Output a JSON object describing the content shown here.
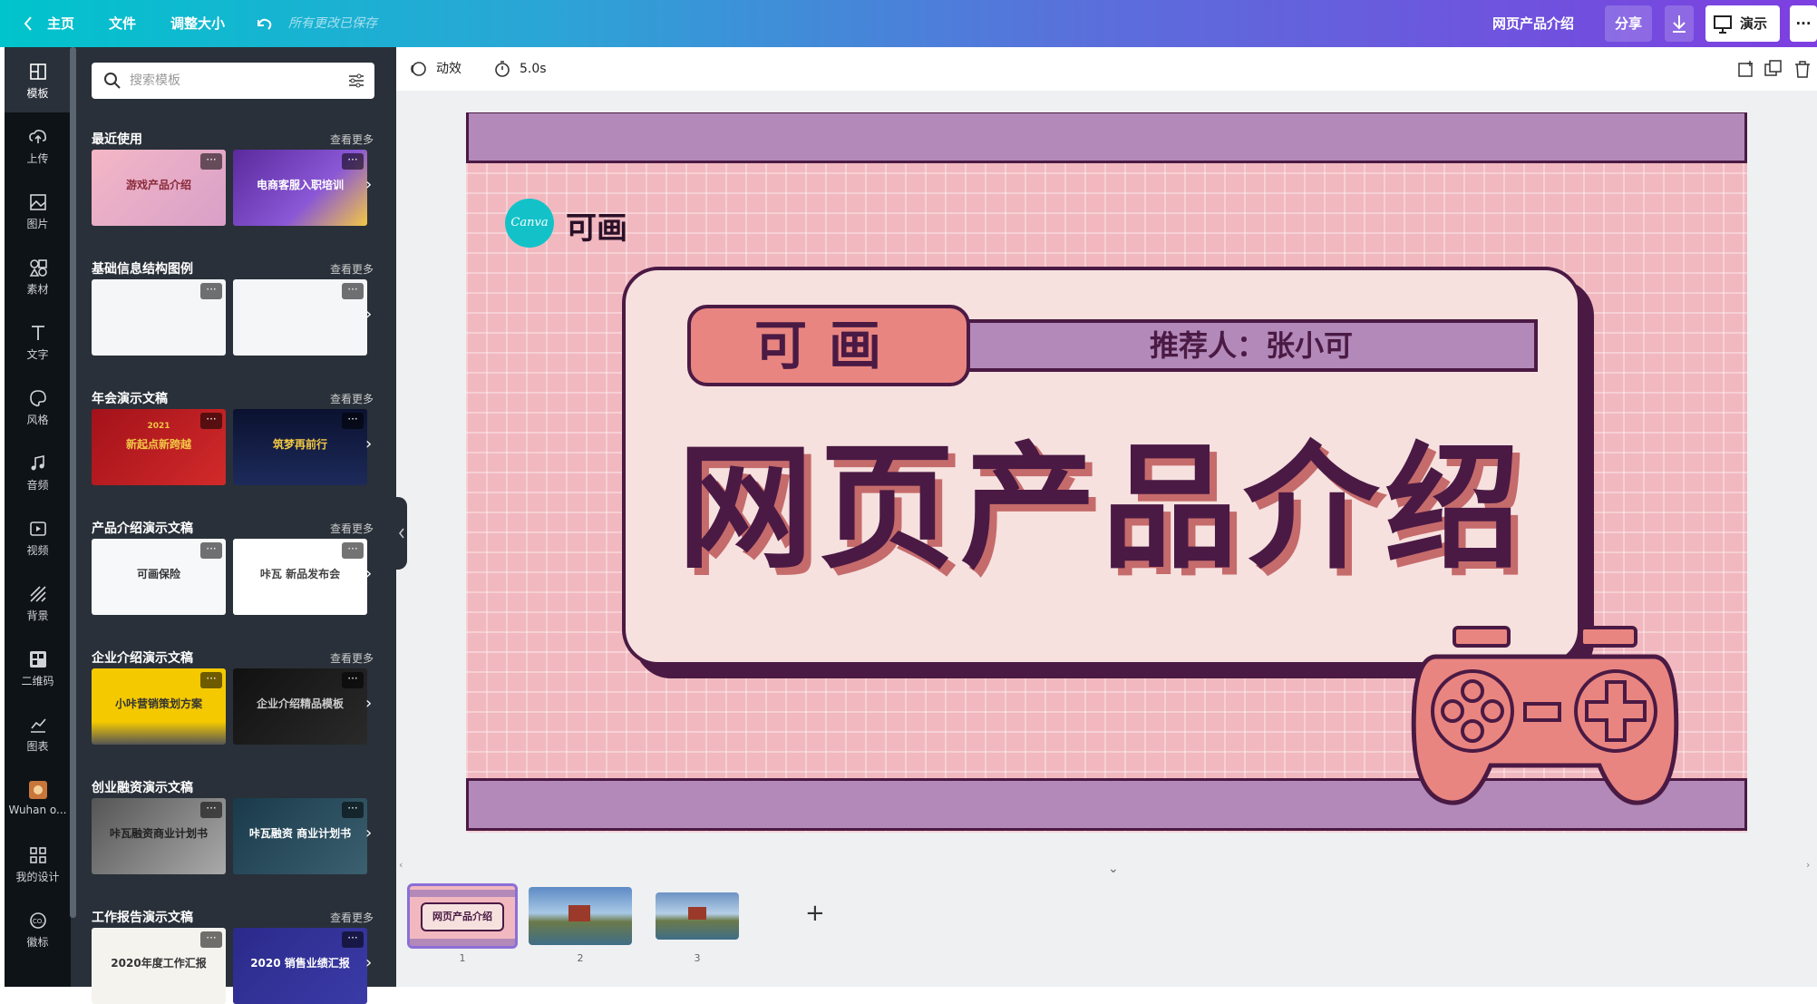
{
  "topbar": {
    "home": "主页",
    "file": "文件",
    "resize": "调整大小",
    "saved": "所有更改已保存",
    "doc_title": "网页产品介绍",
    "share": "分享",
    "present": "演示",
    "more": "···"
  },
  "rail": {
    "items": [
      {
        "label": "模板",
        "icon": "template-icon"
      },
      {
        "label": "上传",
        "icon": "upload-icon"
      },
      {
        "label": "图片",
        "icon": "image-icon"
      },
      {
        "label": "素材",
        "icon": "elements-icon"
      },
      {
        "label": "文字",
        "icon": "text-icon"
      },
      {
        "label": "风格",
        "icon": "palette-icon"
      },
      {
        "label": "音频",
        "icon": "audio-icon"
      },
      {
        "label": "视频",
        "icon": "video-icon"
      },
      {
        "label": "背景",
        "icon": "background-icon"
      },
      {
        "label": "二维码",
        "icon": "qrcode-icon"
      },
      {
        "label": "图表",
        "icon": "chart-icon"
      },
      {
        "label": "Wuhan o...",
        "icon": "app-icon"
      },
      {
        "label": "我的设计",
        "icon": "grid-icon"
      },
      {
        "label": "徽标",
        "icon": "logo-icon"
      }
    ]
  },
  "panel": {
    "search_placeholder": "搜索模板",
    "see_more": "查看更多",
    "sections": [
      {
        "title": "最近使用",
        "thumbs": [
          "游戏产品介绍",
          "电商客服入职培训"
        ]
      },
      {
        "title": "基础信息结构图例",
        "thumbs": [
          "",
          ""
        ]
      },
      {
        "title": "年会演示文稿",
        "thumbs": [
          "新起点新跨越",
          "筑梦再前行"
        ]
      },
      {
        "title": "产品介绍演示文稿",
        "thumbs": [
          "可画保险",
          "咔瓦 新品发布会"
        ]
      },
      {
        "title": "企业介绍演示文稿",
        "thumbs": [
          "小咔营销策划方案",
          "企业介绍精品模板"
        ]
      },
      {
        "title": "创业融资演示文稿",
        "thumbs": [
          "咔瓦融资商业计划书",
          "咔瓦融资 商业计划书"
        ]
      },
      {
        "title": "工作报告演示文稿",
        "thumbs": [
          "2020年度工作汇报",
          "2020 销售业绩汇报"
        ]
      }
    ],
    "thumb_year": "2021"
  },
  "toolbar": {
    "animate": "动效",
    "duration": "5.0s"
  },
  "slide": {
    "logo_badge": "Canva",
    "logo_text": "可画",
    "pill": "可画",
    "recommender": "推荐人：张小可",
    "title": "网页产品介绍"
  },
  "pages": {
    "numbers": [
      "1",
      "2",
      "3"
    ],
    "add": "+"
  },
  "colors": {
    "slide_pink": "#f1b8bf",
    "slide_purple": "#b289b8",
    "slide_dark": "#4a1a44",
    "accent_coral": "#e98580",
    "canva_teal": "#13c2c8"
  }
}
